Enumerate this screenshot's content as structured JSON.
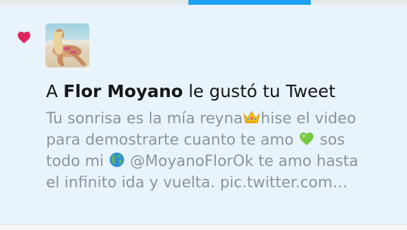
{
  "tabs": {
    "active_color": "#1da1f2"
  },
  "notification": {
    "type_icon": "heart-icon",
    "icon_color": "#e0245e",
    "avatar_icon": "profile-photo",
    "headline": {
      "prefix": "A ",
      "user_name": "Flor Moyano",
      "suffix": " le gustó tu Tweet"
    },
    "tweet": {
      "line1_a": "Tu sonrisa es la mía reyna",
      "line1_emoji": "crown-emoji",
      "line1_b": "hise el video",
      "line2_a": "para demostrarte cuanto te amo ",
      "line2_emoji": "green-heart-emoji",
      "line2_b": " sos",
      "line3_a": "todo mi ",
      "line3_emoji": "globe-emoji",
      "line3_b": " @MoyanoFlorOk te amo hasta",
      "line4": "el infinito ida y vuelta. pic.twitter.com…"
    }
  }
}
